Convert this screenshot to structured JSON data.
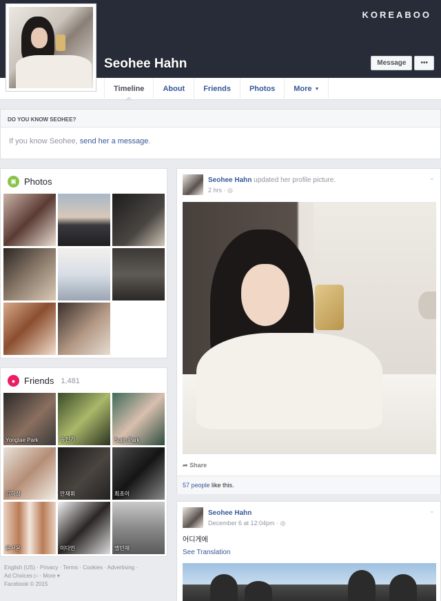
{
  "watermark": "KOREABOO",
  "profile": {
    "name": "Seohee Hahn"
  },
  "cover_actions": {
    "message": "Message",
    "more": "•••"
  },
  "tabs": [
    {
      "label": "Timeline"
    },
    {
      "label": "About"
    },
    {
      "label": "Friends"
    },
    {
      "label": "Photos"
    },
    {
      "label": "More"
    }
  ],
  "know_box": {
    "title": "DO YOU KNOW SEOHEE?",
    "text": "If you know Seohee, ",
    "link": "send her a message",
    "end": "."
  },
  "photos_section": {
    "title": "Photos"
  },
  "friends_section": {
    "title": "Friends",
    "count": "1,481",
    "friends": [
      {
        "name": "Yongtae Park"
      },
      {
        "name": "송진기"
      },
      {
        "name": "Sujin Park"
      },
      {
        "name": "김하성"
      },
      {
        "name": "안재휘"
      },
      {
        "name": "최초이"
      },
      {
        "name": "윤서윤"
      },
      {
        "name": "이다인"
      },
      {
        "name": "맹민재"
      }
    ]
  },
  "footer": {
    "line1": "English (US) · Privacy · Terms · Cookies · Advertising ·",
    "line2": "Ad Choices ▷ · More ▾",
    "line3": "Facebook © 2015"
  },
  "post1": {
    "author": "Seohee Hahn",
    "action": " updated her profile picture.",
    "time": "2 hrs · ",
    "share": "Share",
    "likes_link": "57 people",
    "likes_rest": " like this."
  },
  "post2": {
    "author": "Seohee Hahn",
    "time": "December 6 at 12:04pm · ",
    "text": "어디게에",
    "see_translation": "See Translation"
  },
  "colors": {
    "cover": "#272c38",
    "link": "#365899",
    "background": "#e9ebee"
  },
  "icons": {
    "photos": "photo-icon",
    "friends": "people-icon",
    "globe": "globe-icon",
    "share": "share-arrow-icon",
    "chevron": "chevron-down-icon"
  }
}
